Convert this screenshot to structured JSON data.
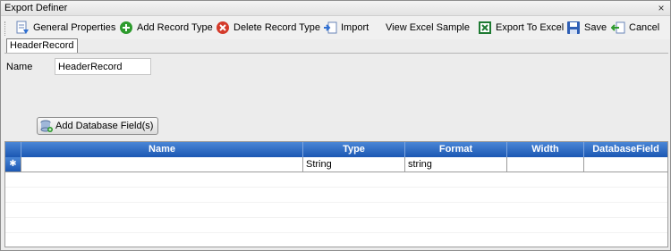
{
  "window": {
    "title": "Export Definer",
    "close_glyph": "×"
  },
  "toolbar": {
    "general_properties": "General Properties",
    "add_record_type": "Add Record Type",
    "delete_record_type": "Delete Record Type",
    "import": "Import",
    "view_excel_sample": "View Excel Sample",
    "export_to_excel": "Export To Excel",
    "save": "Save",
    "cancel": "Cancel"
  },
  "tabs": [
    {
      "label": "HeaderRecord",
      "selected": true
    }
  ],
  "form": {
    "name_label": "Name",
    "name_value": "HeaderRecord"
  },
  "add_db_field_label": "Add Database Field(s)",
  "grid": {
    "columns": [
      "Name",
      "Type",
      "Format",
      "Width",
      "DatabaseField"
    ],
    "rows": [
      {
        "indicator": "✱",
        "name": "",
        "type": "String",
        "format": "string",
        "width": "",
        "database_field": ""
      }
    ]
  },
  "colors": {
    "header_blue": "#1b57b3",
    "accent_green": "#2e9b2e",
    "delete_red": "#d43a2a"
  }
}
